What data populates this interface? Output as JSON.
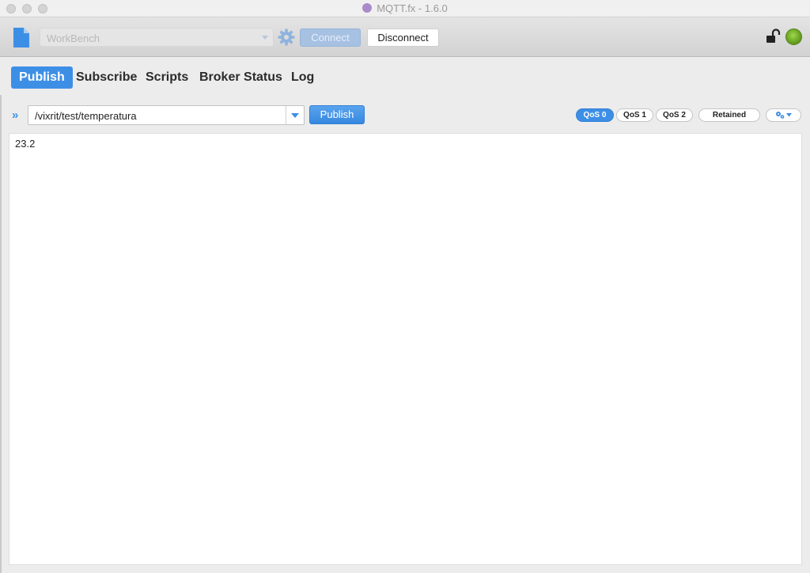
{
  "window": {
    "title": "MQTT.fx - 1.6.0"
  },
  "toolbar": {
    "profile_value": "WorkBench",
    "connect_label": "Connect",
    "disconnect_label": "Disconnect",
    "status_color": "#7ab32e"
  },
  "tabs": [
    {
      "label": "Publish",
      "active": true
    },
    {
      "label": "Subscribe",
      "active": false
    },
    {
      "label": "Scripts",
      "active": false
    },
    {
      "label": "Broker Status",
      "active": false
    },
    {
      "label": "Log",
      "active": false
    }
  ],
  "publish": {
    "topic": "/vixrit/test/temperatura",
    "publish_label": "Publish",
    "qos": [
      {
        "label": "QoS 0",
        "active": true
      },
      {
        "label": "QoS 1",
        "active": false
      },
      {
        "label": "QoS 2",
        "active": false
      }
    ],
    "retained_label": "Retained",
    "payload": "23.2"
  },
  "colors": {
    "accent": "#3d8fe6"
  }
}
